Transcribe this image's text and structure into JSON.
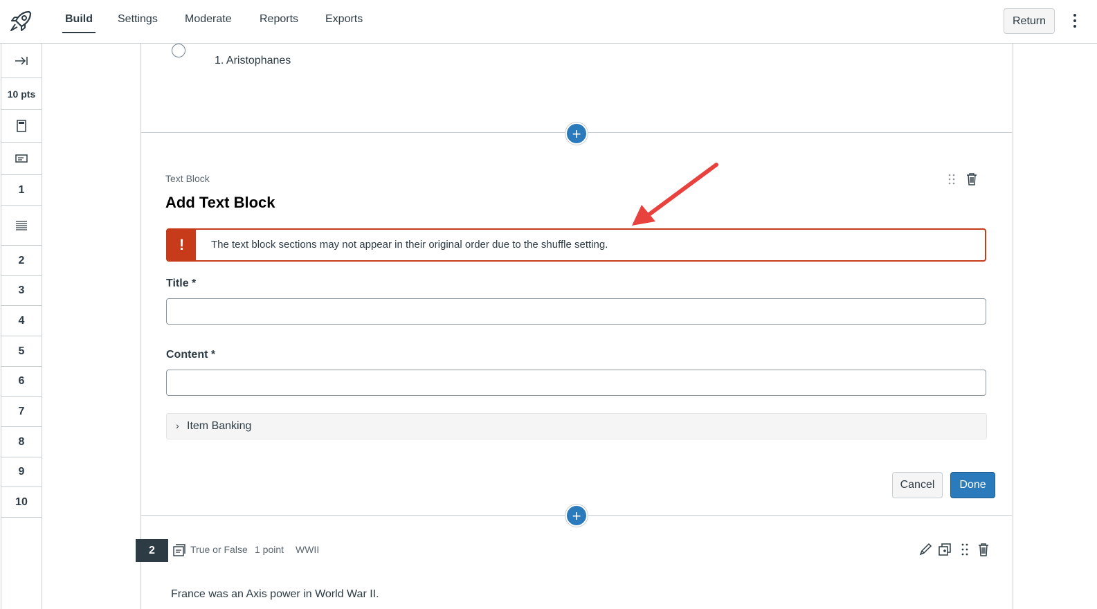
{
  "topnav": {
    "tabs": [
      {
        "label": "Build",
        "active": true
      },
      {
        "label": "Settings",
        "active": false
      },
      {
        "label": "Moderate",
        "active": false
      },
      {
        "label": "Reports",
        "active": false
      },
      {
        "label": "Exports",
        "active": false
      }
    ],
    "return_label": "Return",
    "logo_icon": "rocket-icon",
    "more_icon": "kebab-icon"
  },
  "sidenav": {
    "collapse_icon": "collapse-right-icon",
    "points": "10 pts",
    "items": [
      "1",
      "2",
      "3",
      "4",
      "5",
      "6",
      "7",
      "8",
      "9",
      "10"
    ]
  },
  "prev_question": {
    "answer": "1. Aristophanes"
  },
  "text_block": {
    "type_label": "Text Block",
    "heading": "Add Text Block",
    "alert": "The text block sections may not appear in their original order due to the shuffle setting.",
    "alert_icon": "!",
    "title_label": "Title *",
    "title_value": "",
    "content_label": "Content *",
    "content_value": "",
    "item_banking_label": "Item Banking",
    "cancel_label": "Cancel",
    "done_label": "Done"
  },
  "next_question": {
    "number": "2",
    "type": "True or False",
    "points": "1 point",
    "tag": "WWII",
    "text": "France was an Axis power in World War II."
  },
  "colors": {
    "accent": "#2b7abc",
    "alert": "#c73a1a",
    "annotation_arrow": "#e8423f",
    "text": "#2d3b45"
  }
}
